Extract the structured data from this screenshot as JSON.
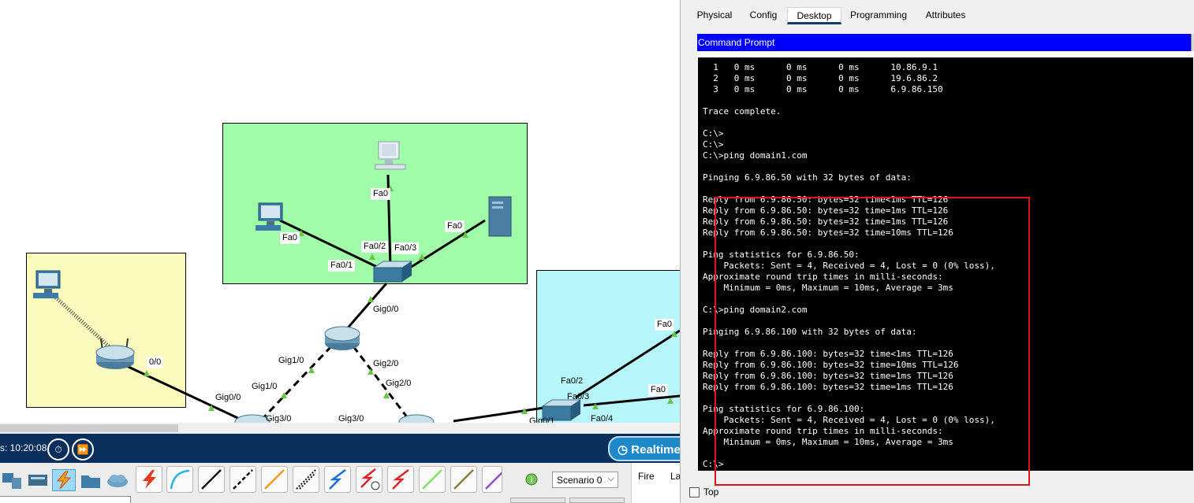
{
  "topology": {
    "labels": [
      {
        "id": "pc-top-fa0",
        "text": "Fa0"
      },
      {
        "id": "pc-left-fa0",
        "text": "Fa0"
      },
      {
        "id": "server-fa0",
        "text": "Fa0"
      },
      {
        "id": "sw-fa0-1",
        "text": "Fa0/1"
      },
      {
        "id": "sw-fa0-2",
        "text": "Fa0/2"
      },
      {
        "id": "sw-fa0-3",
        "text": "Fa0/3"
      },
      {
        "id": "sw-gig0-0",
        "text": "Gig0/0"
      },
      {
        "id": "r-gig1-0",
        "text": "Gig1/0"
      },
      {
        "id": "r-gig2-0",
        "text": "Gig2/0"
      },
      {
        "id": "r2-gig1-0",
        "text": "Gig1/0"
      },
      {
        "id": "r3-gig2-0",
        "text": "Gig2/0"
      },
      {
        "id": "wr-0-0",
        "text": "0/0"
      },
      {
        "id": "r2-gig0-0",
        "text": "Gig0/0"
      },
      {
        "id": "r2-gig3-0",
        "text": "Gig3/0"
      },
      {
        "id": "r3-gig3-0",
        "text": "Gig3/0"
      },
      {
        "id": "sw2-fa0-2",
        "text": "Fa0/2"
      },
      {
        "id": "sw2-fa0-3",
        "text": "Fa0/3"
      },
      {
        "id": "sw2-fa0-4",
        "text": "Fa0/4"
      },
      {
        "id": "sw2-gig0-1",
        "text": "Gig0/1"
      },
      {
        "id": "cy-fa0-a",
        "text": "Fa0"
      },
      {
        "id": "cy-fa0-b",
        "text": "Fa0"
      }
    ]
  },
  "statusbar": {
    "clock": "s: 10:20:08",
    "realtime_label": "Realtime"
  },
  "devicebar": {
    "scenario": "Scenario 0",
    "fire_label": "Fire",
    "last_label": "La"
  },
  "panel": {
    "tabs": [
      "Physical",
      "Config",
      "Desktop",
      "Programming",
      "Attributes"
    ],
    "active_tab": "Desktop",
    "cmd_title": "Command Prompt",
    "top_checkbox_label": "Top"
  },
  "terminal": {
    "lines": [
      "  1   0 ms      0 ms      0 ms      10.86.9.1",
      "  2   0 ms      0 ms      0 ms      19.6.86.2",
      "  3   0 ms      0 ms      0 ms      6.9.86.150",
      "",
      "Trace complete.",
      "",
      "C:\\>",
      "C:\\>",
      "C:\\>ping domain1.com",
      "",
      "Pinging 6.9.86.50 with 32 bytes of data:",
      "",
      "Reply from 6.9.86.50: bytes=32 time<1ms TTL=126",
      "Reply from 6.9.86.50: bytes=32 time=1ms TTL=126",
      "Reply from 6.9.86.50: bytes=32 time=1ms TTL=126",
      "Reply from 6.9.86.50: bytes=32 time=10ms TTL=126",
      "",
      "Ping statistics for 6.9.86.50:",
      "    Packets: Sent = 4, Received = 4, Lost = 0 (0% loss),",
      "Approximate round trip times in milli-seconds:",
      "    Minimum = 0ms, Maximum = 10ms, Average = 3ms",
      "",
      "C:\\>ping domain2.com",
      "",
      "Pinging 6.9.86.100 with 32 bytes of data:",
      "",
      "Reply from 6.9.86.100: bytes=32 time<1ms TTL=126",
      "Reply from 6.9.86.100: bytes=32 time=10ms TTL=126",
      "Reply from 6.9.86.100: bytes=32 time=1ms TTL=126",
      "Reply from 6.9.86.100: bytes=32 time=1ms TTL=126",
      "",
      "Ping statistics for 6.9.86.100:",
      "    Packets: Sent = 4, Received = 4, Lost = 0 (0% loss),",
      "Approximate round trip times in milli-seconds:",
      "    Minimum = 0ms, Maximum = 10ms, Average = 3ms",
      "",
      "C:\\>"
    ]
  },
  "colors": {
    "green_area": "#a0fca8",
    "yellow_area": "#fbfbbd",
    "cyan_area": "#b6f6fb",
    "cmd_title": "#0000ff",
    "highlight": "#e0121b",
    "statusbar": "#0a2f5c"
  },
  "icons": [
    "pc-icon",
    "server-icon",
    "switch-icon",
    "router-icon",
    "wireless-router-icon",
    "timer-icon",
    "fast-forward-icon",
    "realtime-clock-icon",
    "lightning-icon",
    "folder-icon",
    "cloud-icon",
    "scenario-info-icon",
    "chevron-down-icon"
  ]
}
